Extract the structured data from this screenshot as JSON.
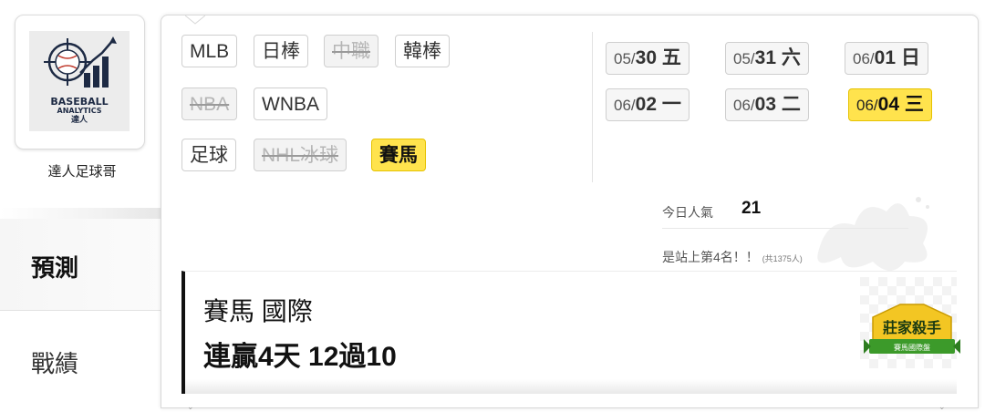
{
  "sidebar": {
    "logo_line1": "BASEBALL",
    "logo_line2": "ANALYTICS",
    "logo_line3": "達人",
    "user_name": "達人足球哥",
    "tabs": [
      {
        "label": "預測",
        "active": true
      },
      {
        "label": "戰績",
        "active": false
      }
    ]
  },
  "leagues": [
    {
      "label": "MLB",
      "state": "normal"
    },
    {
      "label": "日棒",
      "state": "normal"
    },
    {
      "label": "中職",
      "state": "disabled"
    },
    {
      "label": "韓棒",
      "state": "normal"
    },
    {
      "label": "NBA",
      "state": "disabled"
    },
    {
      "label": "WNBA",
      "state": "normal"
    },
    {
      "label": "足球",
      "state": "normal"
    },
    {
      "label": "NHL冰球",
      "state": "disabled"
    },
    {
      "label": "賽馬",
      "state": "active"
    }
  ],
  "dates": [
    {
      "md": "05/",
      "day": "30 五",
      "active": false
    },
    {
      "md": "05/",
      "day": "31 六",
      "active": false
    },
    {
      "md": "06/",
      "day": "01 日",
      "active": false
    },
    {
      "md": "06/",
      "day": "02 一",
      "active": false
    },
    {
      "md": "06/",
      "day": "03 二",
      "active": false
    },
    {
      "md": "06/",
      "day": "04 三",
      "active": true
    }
  ],
  "popularity": {
    "label": "今日人氣",
    "value": "21",
    "rank_text": "是站上第4名！！",
    "rank_sub": "(共1375人)"
  },
  "result": {
    "title": "賽馬 國際",
    "streak": "連贏4天 12過10",
    "badge_line1": "莊家殺手",
    "badge_line2": "賽馬國際盤"
  },
  "colors": {
    "active_yellow": "#ffe34d",
    "disabled_text": "#b5b5b5",
    "badge_green": "#3c9a2a",
    "logo_navy": "#1d2a44"
  }
}
